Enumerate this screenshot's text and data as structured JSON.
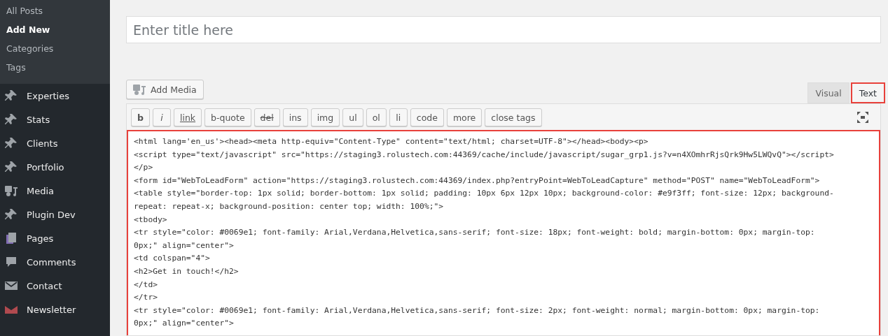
{
  "sidebar": {
    "submenu": [
      {
        "label": "All Posts",
        "selected": false
      },
      {
        "label": "Add New",
        "selected": true
      },
      {
        "label": "Categories",
        "selected": false
      },
      {
        "label": "Tags",
        "selected": false
      }
    ],
    "items": [
      {
        "label": "Experties",
        "kind": "pin"
      },
      {
        "label": "Stats",
        "kind": "pin"
      },
      {
        "label": "Clients",
        "kind": "pin"
      },
      {
        "label": "Portfolio",
        "kind": "pin"
      },
      {
        "label": "Media",
        "kind": "media"
      },
      {
        "label": "Plugin Dev",
        "kind": "pin"
      },
      {
        "label": "Pages",
        "kind": "pages"
      },
      {
        "label": "Comments",
        "kind": "comment"
      },
      {
        "label": "Contact",
        "kind": "mail"
      },
      {
        "label": "Newsletter",
        "kind": "newsletter"
      }
    ]
  },
  "title_field": {
    "placeholder": "Enter title here"
  },
  "add_media": {
    "label": "Add Media"
  },
  "editor_tabs": [
    {
      "label": "Visual",
      "selected": false,
      "highlighted": false
    },
    {
      "label": "Text",
      "selected": true,
      "highlighted": true
    }
  ],
  "quicktags": [
    {
      "label": "b",
      "kind": "bold"
    },
    {
      "label": "i",
      "kind": "italic"
    },
    {
      "label": "link",
      "kind": "link"
    },
    {
      "label": "b-quote",
      "kind": "plain"
    },
    {
      "label": "del",
      "kind": "strike"
    },
    {
      "label": "ins",
      "kind": "plain"
    },
    {
      "label": "img",
      "kind": "plain"
    },
    {
      "label": "ul",
      "kind": "plain"
    },
    {
      "label": "ol",
      "kind": "plain"
    },
    {
      "label": "li",
      "kind": "plain"
    },
    {
      "label": "code",
      "kind": "plain"
    },
    {
      "label": "more",
      "kind": "plain"
    },
    {
      "label": "close tags",
      "kind": "plain"
    }
  ],
  "code_area": {
    "highlighted": true,
    "lines": [
      "<html lang='en_us'><head><meta http-equiv=\"Content-Type\" content=\"text/html; charset=UTF-8\"></head><body><p>",
      "<script type=\"text/javascript\" src=\"https://staging3.rolustech.com:44369/cache/include/javascript/sugar_grp1.js?v=n4XOmhrRjsQrk9Hw5LWQvQ\"></script>",
      "</p>",
      "<form id=\"WebToLeadForm\" action=\"https://staging3.rolustech.com:44369/index.php?entryPoint=WebToLeadCapture\" method=\"POST\" name=\"WebToLeadForm\">",
      "<table style=\"border-top: 1px solid; border-bottom: 1px solid; padding: 10px 6px 12px 10px; background-color: #e9f3ff; font-size: 12px; background-",
      "repeat: repeat-x; background-position: center top; width: 100%;\">",
      "<tbody>",
      "<tr style=\"color: #0069e1; font-family: Arial,Verdana,Helvetica,sans-serif; font-size: 18px; font-weight: bold; margin-bottom: 0px; margin-top:",
      "0px;\" align=\"center\">",
      "<td colspan=\"4\">",
      "<h2>Get in touch!</h2>",
      "</td>",
      "</tr>",
      "<tr style=\"color: #0069e1; font-family: Arial,Verdana,Helvetica,sans-serif; font-size: 2px; font-weight: normal; margin-bottom: 0px; margin-top:",
      "0px;\" align=\"center\">"
    ]
  }
}
